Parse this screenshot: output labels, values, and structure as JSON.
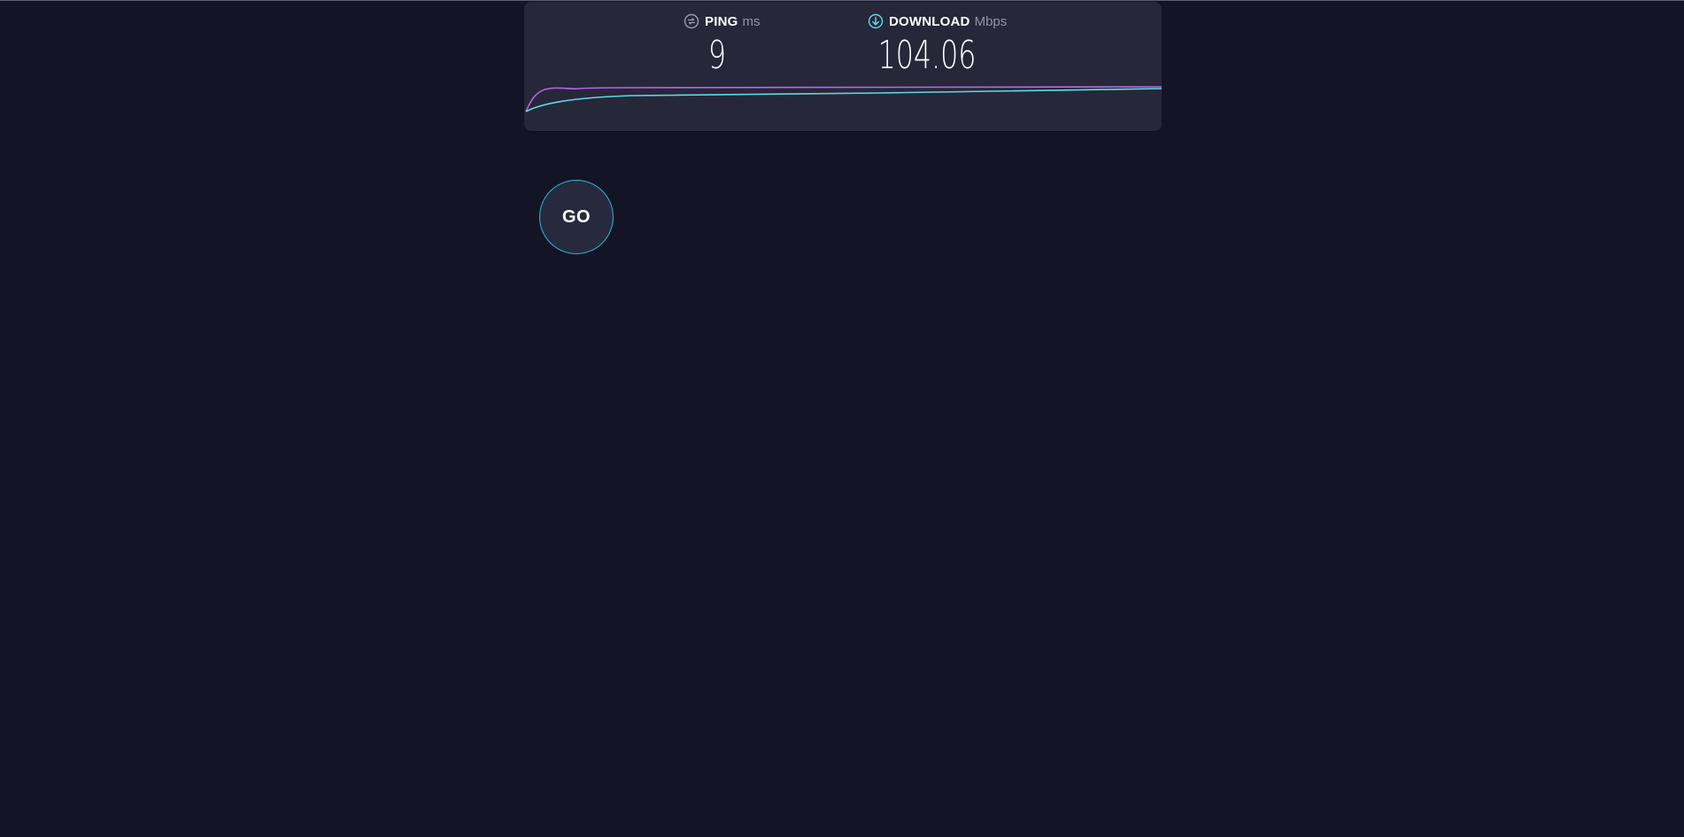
{
  "results": {
    "ping": {
      "label": "PING",
      "unit": "ms",
      "value": "9",
      "icon": "ping-icon"
    },
    "download": {
      "label": "DOWNLOAD",
      "unit": "Mbps",
      "value": "104.06",
      "icon": "download-icon"
    }
  },
  "start_button": {
    "label": "GO"
  },
  "colors": {
    "background": "#131526",
    "panel": "#262739",
    "ping_line": "#b667e8",
    "download_line": "#5fd8e8",
    "accent_ring": "#2fb6d8"
  }
}
